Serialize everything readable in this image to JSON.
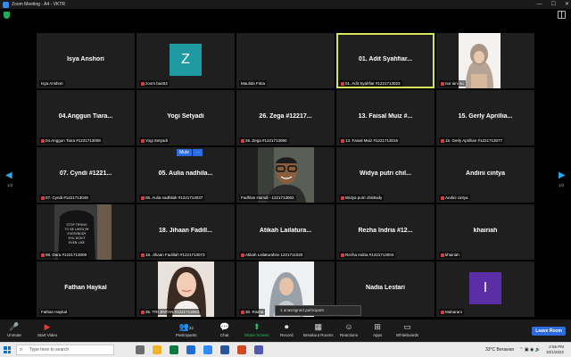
{
  "window": {
    "title": "Zoom Meeting - A4 - VKTR"
  },
  "participants": [
    {
      "name": "Isya Anshori",
      "tag": "Isya Anshori",
      "type": "name"
    },
    {
      "name": "Z",
      "tag": "zoom ba404",
      "type": "avatar",
      "color": "#1f9aa3"
    },
    {
      "name": "",
      "tag": "Maulida Fitria",
      "type": "blank"
    },
    {
      "name": "01. Adit Syahfiar...",
      "tag": "01. Adit Syahfiar #1221713023",
      "type": "name",
      "active": true
    },
    {
      "name": "",
      "tag": "nur aini su",
      "type": "photo",
      "photo": "hijab"
    },
    {
      "name": "04.Anggun Tiara...",
      "tag": "04.Anggun Tiara #1221713008",
      "type": "name"
    },
    {
      "name": "Yogi Setyadi",
      "tag": "Yogi Setyadi",
      "type": "name"
    },
    {
      "name": "26. Zega #12217...",
      "tag": "26. Zega #1221713060",
      "type": "name"
    },
    {
      "name": "13. Faisal Muiz #...",
      "tag": "13. Faisal Muiz #1221713016",
      "type": "name"
    },
    {
      "name": "15. Gerly Aprillia...",
      "tag": "15. Gerly Aprillian #1221713077",
      "type": "name"
    },
    {
      "name": "07. Cyndi #1221...",
      "tag": "07. Cyndi #1221713049",
      "type": "name"
    },
    {
      "name": "05. Aulia nadhila...",
      "tag": "05. Aulia nadhilah #1221713037",
      "type": "name"
    },
    {
      "name": "",
      "tag": "Fadhlan Hamdi - 1221713002",
      "type": "photo",
      "photo": "man"
    },
    {
      "name": "Widya putri chil...",
      "tag": "Widya putri childnidy",
      "type": "name"
    },
    {
      "name": "Andini cintya",
      "tag": "Andini cintya",
      "type": "name"
    },
    {
      "name": "",
      "tag": "08. Dara #1221713009",
      "type": "photo",
      "photo": "shirt"
    },
    {
      "name": "18. Jihaan Fadill...",
      "tag": "18. Jihaan Fadillah #1221713073",
      "type": "name"
    },
    {
      "name": "Atikah Lailatura...",
      "tag": "Atikah Lailaturahmi 1221711020",
      "type": "name"
    },
    {
      "name": "Rezha Indria #12...",
      "tag": "Rezha Indria #1221713004",
      "type": "name"
    },
    {
      "name": "khairiah",
      "tag": "khairiah",
      "type": "name"
    },
    {
      "name": "Fathan Haykal",
      "tag": "Fathan Haykal",
      "type": "name"
    },
    {
      "name": "",
      "tag": "35. TRI JINTAN #1221713062",
      "type": "photo",
      "photo": "woman"
    },
    {
      "name": "",
      "tag": "30. Risma",
      "type": "photo",
      "photo": "hijab2"
    },
    {
      "name": "Nadia Lestari",
      "tag": "",
      "type": "name"
    },
    {
      "name": "I",
      "tag": "Maharani",
      "type": "avatar",
      "color": "#5b2ea6"
    }
  ],
  "mute_badge": {
    "label": "Mute",
    "more": "···"
  },
  "nav": {
    "left_page": "1/2",
    "right_page": "1/2"
  },
  "unassigned": "1 unassigned participant",
  "toolbar": {
    "unmute": "Unmute",
    "start_video": "Start Video",
    "participants": "Participants",
    "participants_count": "32",
    "chat": "Chat",
    "share_screen": "Share Screen",
    "record": "Record",
    "breakout_rooms": "Breakout Rooms",
    "reactions": "Reactions",
    "apps": "Apps",
    "whiteboards": "Whiteboards",
    "leave": "Leave Room"
  },
  "taskbar": {
    "search_placeholder": "Type here to search",
    "weather": "33°C  Berawan",
    "time": "2:56 PM",
    "date": "10/1/2022"
  }
}
